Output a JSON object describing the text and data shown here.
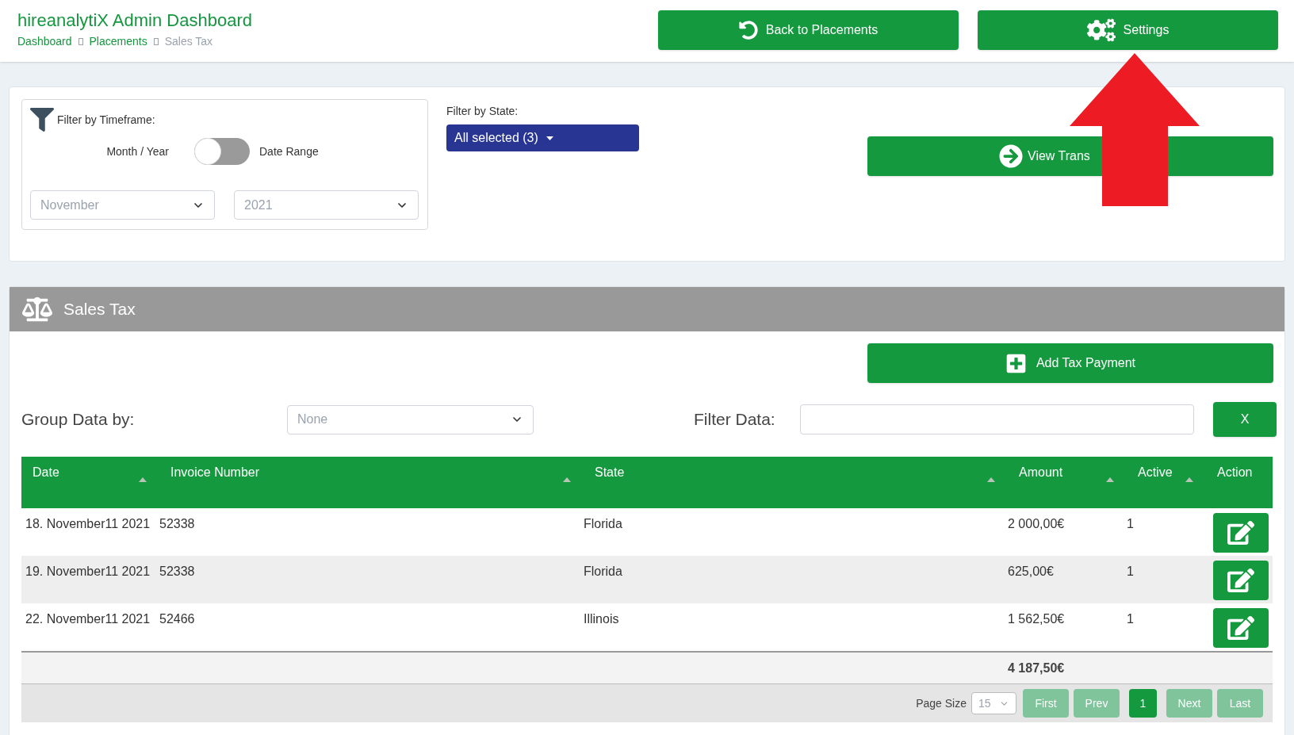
{
  "header": {
    "title": "hireanalytiX Admin Dashboard",
    "breadcrumbs": [
      {
        "label": "Dashboard",
        "current": false
      },
      {
        "label": "Placements",
        "current": false
      },
      {
        "label": "Sales Tax",
        "current": true
      }
    ],
    "buttons": [
      {
        "kind": "back",
        "label": "Back to Placements"
      },
      {
        "kind": "settings",
        "label": "Settings"
      }
    ]
  },
  "filters": {
    "timeframe_title": "Filter by Timeframe:",
    "toggle": {
      "left_label": "Month / Year",
      "right_label": "Date Range",
      "on": false
    },
    "month": "November",
    "year": "2021",
    "state_label": "Filter by State:",
    "state_value": "All selected (3)",
    "view_button": "View Trans"
  },
  "annotation": {
    "kind": "arrow"
  },
  "panel": {
    "title": "Sales Tax",
    "add_button": "Add Tax Payment",
    "group_label": "Group Data by:",
    "group_value": "None",
    "filter_label": "Filter Data:",
    "clear_button": "X"
  },
  "table": {
    "columns": [
      {
        "label": "Date",
        "sortable": true
      },
      {
        "label": "Invoice Number",
        "sortable": true
      },
      {
        "label": "State",
        "sortable": true
      },
      {
        "label": "Amount",
        "sortable": true
      },
      {
        "label": "Active",
        "sortable": true
      },
      {
        "label": "Action",
        "sortable": false
      }
    ],
    "rows": [
      {
        "date": "18. November11 2021",
        "invoice": "52338",
        "state": "Florida",
        "amount": "2 000,00€",
        "active": "1"
      },
      {
        "date": "19. November11 2021",
        "invoice": "52338",
        "state": "Florida",
        "amount": "625,00€",
        "active": "1"
      },
      {
        "date": "22. November11 2021",
        "invoice": "52466",
        "state": "Illinois",
        "amount": "1 562,50€",
        "active": "1"
      }
    ],
    "total": "4 187,50€"
  },
  "pager": {
    "page_size_label": "Page Size",
    "page_size": "15",
    "buttons": [
      {
        "label": "First",
        "disabled": true,
        "selected": false
      },
      {
        "label": "Prev",
        "disabled": true,
        "selected": false
      },
      {
        "label": "1",
        "disabled": false,
        "selected": true
      },
      {
        "label": "Next",
        "disabled": true,
        "selected": false
      },
      {
        "label": "Last",
        "disabled": true,
        "selected": false
      }
    ]
  }
}
